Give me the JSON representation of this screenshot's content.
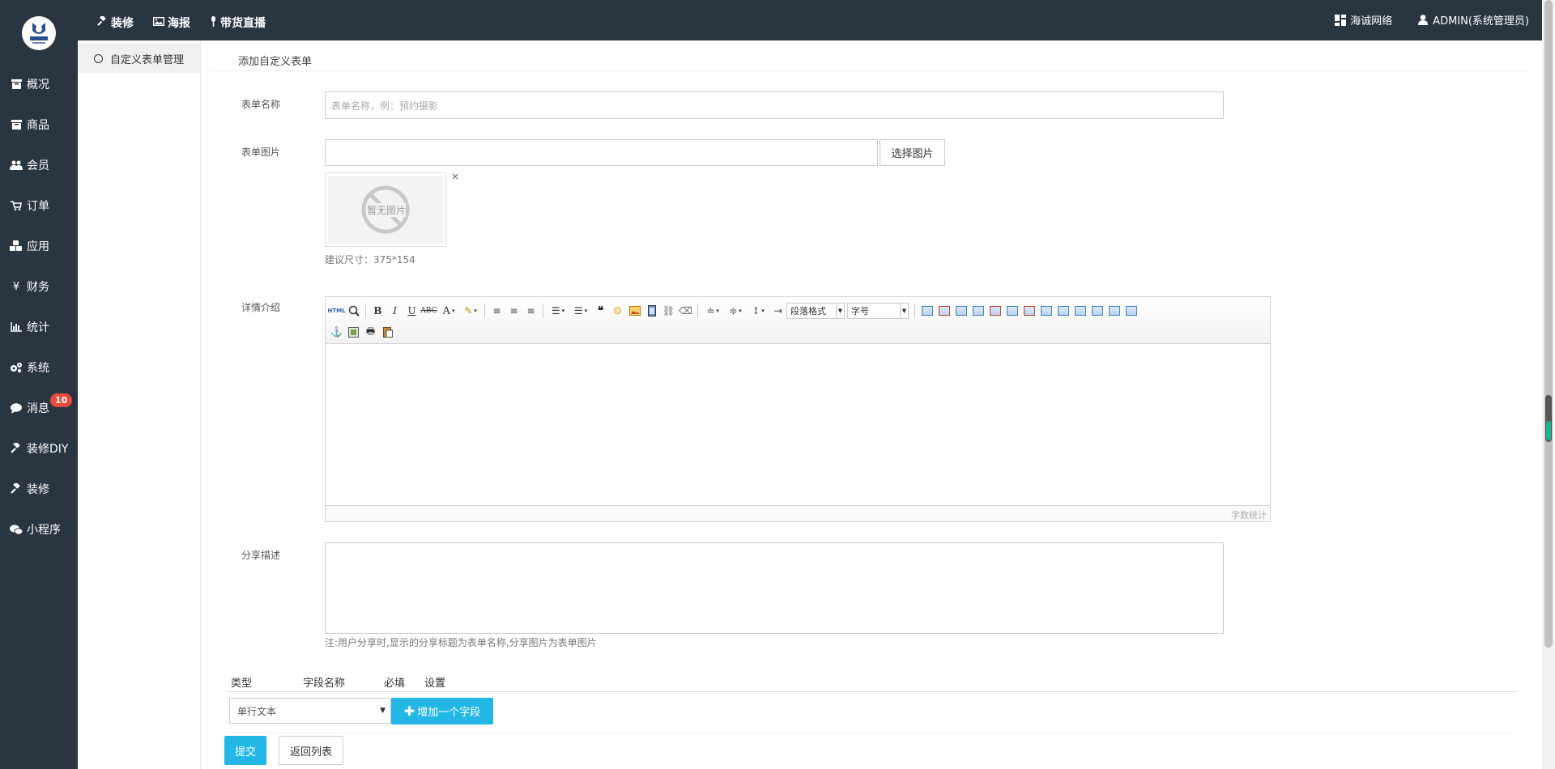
{
  "colors": {
    "sidebar_bg": "#2a3542",
    "accent": "#23b7e5",
    "badge": "#e84a3c"
  },
  "sidebar": {
    "items": [
      {
        "label": "概况",
        "icon": "archive-icon"
      },
      {
        "label": "商品",
        "icon": "archive-icon"
      },
      {
        "label": "会员",
        "icon": "users-icon"
      },
      {
        "label": "订单",
        "icon": "cart-icon"
      },
      {
        "label": "应用",
        "icon": "cubes-icon"
      },
      {
        "label": "财务",
        "icon": "yen-icon"
      },
      {
        "label": "统计",
        "icon": "bar-chart-icon"
      },
      {
        "label": "系统",
        "icon": "gears-icon"
      },
      {
        "label": "消息",
        "icon": "comment-icon",
        "badge": "10"
      },
      {
        "label": "装修DIY",
        "icon": "gavel-icon"
      },
      {
        "label": "装修",
        "icon": "gavel-icon"
      },
      {
        "label": "小程序",
        "icon": "wechat-icon"
      }
    ]
  },
  "topbar": {
    "left": [
      {
        "label": "装修",
        "icon": "gavel-icon"
      },
      {
        "label": "海报",
        "icon": "image-icon"
      },
      {
        "label": "带货直播",
        "icon": "microphone-icon"
      }
    ],
    "org": "海诚网络",
    "user": "ADMIN(系统管理员)"
  },
  "subnav": {
    "active": "自定义表单管理"
  },
  "page": {
    "title": "添加自定义表单"
  },
  "form": {
    "name_label": "表单名称",
    "name_placeholder": "表单名称，例：预约摄影",
    "image_label": "表单图片",
    "image_button": "选择图片",
    "image_placeholder_text": "暂无图片",
    "image_hint": "建议尺寸：375*154",
    "detail_label": "详情介绍",
    "editor_paragraph": "段落格式",
    "editor_fontsize": "字号",
    "editor_wordcount": "字数统计",
    "share_label": "分享描述",
    "share_hint": "注:用户分享时,显示的分享标题为表单名称,分享图片为表单图片"
  },
  "fields_table": {
    "headers": [
      "类型",
      "字段名称",
      "必填",
      "设置"
    ],
    "type_selected": "单行文本",
    "add_button": "增加一个字段"
  },
  "actions": {
    "submit": "提交",
    "back": "返回列表"
  }
}
